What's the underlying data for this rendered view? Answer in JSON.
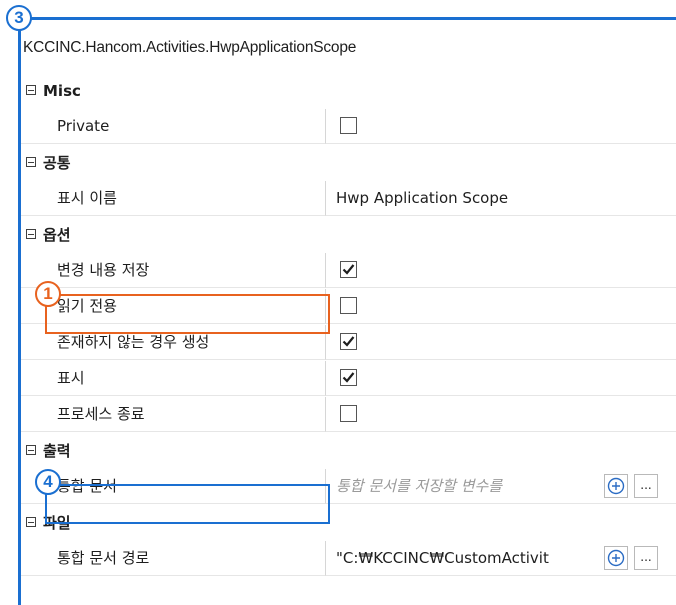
{
  "title": "KCCINC.Hancom.Activities.HwpApplicationScope",
  "markers": {
    "m1": "1",
    "m3": "3",
    "m4": "4"
  },
  "colors": {
    "panel_border": "#1a6fd1",
    "highlight_orange": "#e8621f",
    "highlight_blue": "#1a6fd1"
  },
  "categories": {
    "misc": "Misc",
    "common": "공통",
    "options": "옵션",
    "output": "출력",
    "file": "파일"
  },
  "props": {
    "private": {
      "label": "Private",
      "checked": false
    },
    "display_name": {
      "label": "표시 이름",
      "value": "Hwp Application Scope"
    },
    "save_changes": {
      "label": "변경 내용 저장",
      "checked": true
    },
    "read_only": {
      "label": "읽기 전용",
      "checked": false
    },
    "create_if_missing": {
      "label": "존재하지 않는 경우 생성",
      "checked": true
    },
    "visible": {
      "label": "표시",
      "checked": true
    },
    "kill_process": {
      "label": "프로세스 종료",
      "checked": false
    },
    "merged_doc": {
      "label": "통합 문서",
      "placeholder": "통합 문서를 저장할 변수를"
    },
    "merged_doc_path": {
      "label": "통합 문서 경로",
      "value": "\"C:₩KCCINC₩CustomActivit"
    }
  },
  "buttons": {
    "plus_icon": "plus-circle-icon",
    "more": "..."
  }
}
